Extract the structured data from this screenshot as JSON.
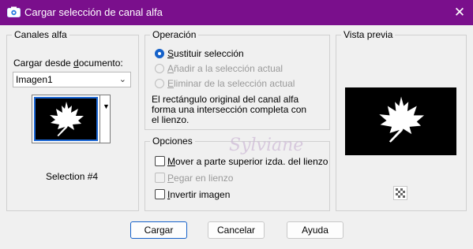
{
  "window": {
    "title": "Cargar selección de canal alfa",
    "close_glyph": "✕"
  },
  "channels": {
    "group_title": "Canales alfa",
    "load_from_label_prefix": "Cargar desde ",
    "load_from_label_underlined": "d",
    "load_from_label_suffix": "ocumento:",
    "document_select_value": "Imagen1",
    "selection_name": "Selection #4"
  },
  "operation": {
    "group_title": "Operación",
    "options": [
      {
        "u": "S",
        "rest": "ustituir selección",
        "checked": true,
        "enabled": true
      },
      {
        "u": "A",
        "rest": "ñadir a la selección actual",
        "checked": false,
        "enabled": false
      },
      {
        "u": "E",
        "rest": "liminar de la selección actual",
        "checked": false,
        "enabled": false
      }
    ],
    "description_lines": [
      "El rectángulo original del canal alfa",
      "forma una intersección completa con",
      "el lienzo."
    ]
  },
  "options": {
    "group_title": "Opciones",
    "items": [
      {
        "u": "M",
        "rest": "over a parte superior izda. del lienzo",
        "checked": false,
        "enabled": true
      },
      {
        "u": "P",
        "rest": "egar en lienzo",
        "checked": false,
        "enabled": false
      },
      {
        "u": "I",
        "rest": "nvertir imagen",
        "checked": false,
        "enabled": true
      }
    ]
  },
  "preview": {
    "group_title": "Vista previa"
  },
  "watermark": "Sylviane",
  "buttons": {
    "load": "Cargar",
    "cancel": "Cancelar",
    "help": "Ayuda"
  },
  "colors": {
    "titlebar": "#7a0f8c",
    "accent": "#1561c9"
  }
}
